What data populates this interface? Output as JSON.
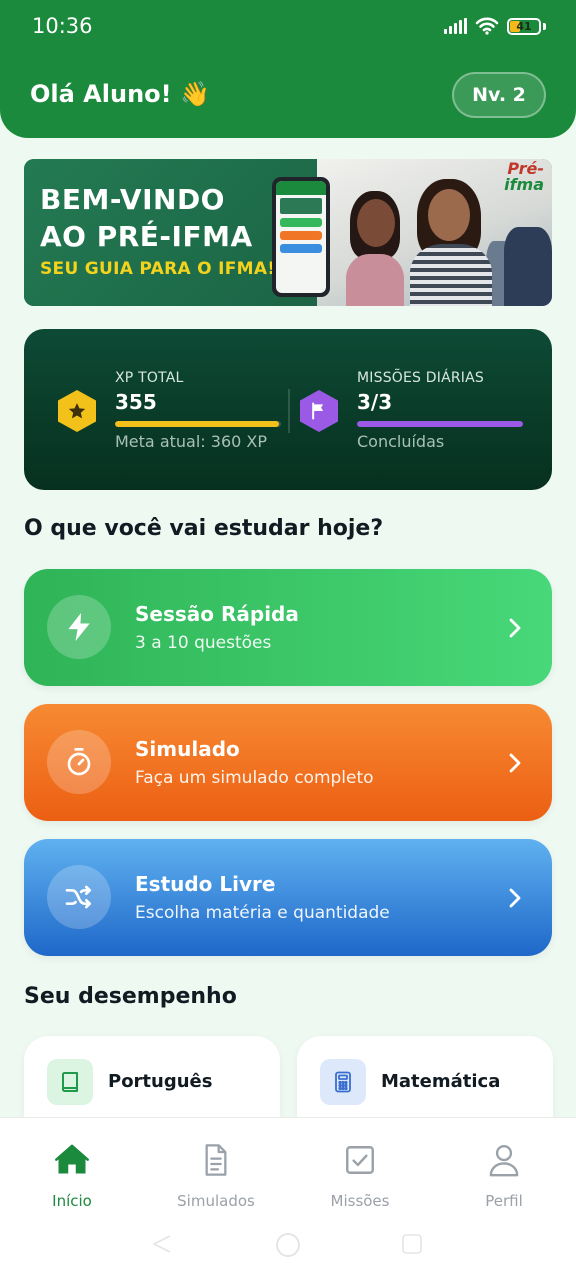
{
  "status_bar": {
    "time": "10:36",
    "battery": "41",
    "battery_level": 0.41
  },
  "header": {
    "greeting": "Olá Aluno! 👋",
    "level": "Nv. 2"
  },
  "banner": {
    "title_line1": "BEM-VINDO",
    "title_line2": "AO PRÉ-IFMA",
    "subtitle": "SEU GUIA PARA O IFMA!",
    "logo_line1": "Pré-",
    "logo_line2": "ifma"
  },
  "stats": {
    "xp": {
      "label": "XP TOTAL",
      "value": "355",
      "note": "Meta atual: 360 XP",
      "progress": 0.986,
      "color": "#f2c21b",
      "icon": "star-icon"
    },
    "missions": {
      "label": "MISSÕES DIÁRIAS",
      "value": "3/3",
      "note": "Concluídas",
      "progress": 1.0,
      "color": "#9b5ae6",
      "icon": "flag-icon"
    }
  },
  "study_section": {
    "title": "O que você vai estudar hoje?",
    "modes": [
      {
        "title": "Sessão Rápida",
        "subtitle": "3 a 10 questões",
        "icon": "lightning-icon",
        "color": "#34b85b"
      },
      {
        "title": "Simulado",
        "subtitle": "Faça um simulado completo",
        "icon": "timer-icon",
        "color": "#f07524"
      },
      {
        "title": "Estudo Livre",
        "subtitle": "Escolha matéria e quantidade",
        "icon": "shuffle-icon",
        "color": "#3a8ee0"
      }
    ]
  },
  "performance_section": {
    "title": "Seu desempenho",
    "subjects": [
      {
        "name": "Português",
        "icon": "book-icon"
      },
      {
        "name": "Matemática",
        "icon": "calculator-icon"
      }
    ]
  },
  "bottom_nav": {
    "active_index": 0,
    "items": [
      {
        "label": "Início",
        "icon": "home-icon"
      },
      {
        "label": "Simulados",
        "icon": "document-icon"
      },
      {
        "label": "Missões",
        "icon": "checkbox-icon"
      },
      {
        "label": "Perfil",
        "icon": "user-icon"
      }
    ]
  }
}
